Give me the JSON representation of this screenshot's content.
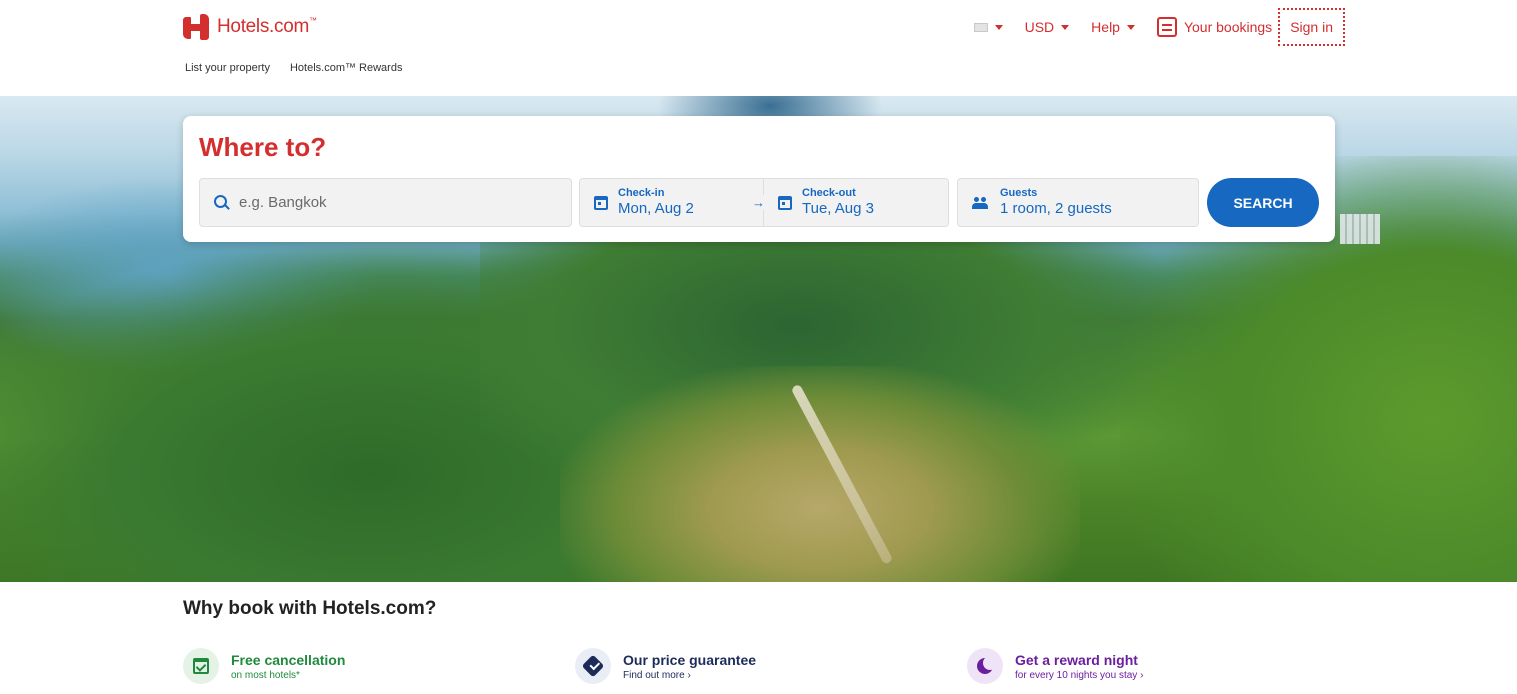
{
  "brand": {
    "name": "Hotels.com",
    "tm": "™"
  },
  "subnav": {
    "list_property": "List your property",
    "rewards": "Hotels.com™ Rewards"
  },
  "topnav": {
    "currency": "USD",
    "help": "Help",
    "bookings": "Your bookings",
    "signin": "Sign in"
  },
  "search": {
    "heading": "Where to?",
    "destination_placeholder": "e.g. Bangkok",
    "checkin_label": "Check-in",
    "checkin_value": "Mon, Aug 2",
    "checkout_label": "Check-out",
    "checkout_value": "Tue, Aug 3",
    "guests_label": "Guests",
    "guests_value": "1 room, 2 guests",
    "button": "SEARCH"
  },
  "why": {
    "heading": "Why book with Hotels.com?",
    "items": [
      {
        "title": "Free cancellation",
        "sub": "on most hotels*",
        "icon": "calendar-check-icon",
        "color": "#1f8a3b"
      },
      {
        "title": "Our price guarantee",
        "sub": "Find out more ›",
        "icon": "verified-badge-icon",
        "color": "#1c2b5a"
      },
      {
        "title": "Get a reward night",
        "sub": "for every 10 nights you stay ›",
        "icon": "moon-icon",
        "color": "#6a1f9e"
      }
    ]
  },
  "colors": {
    "brand_red": "#d32f2f",
    "action_blue": "#1668c1"
  },
  "hero_image": "aerial view of green mountains and hiking trail with sea and city in distance"
}
